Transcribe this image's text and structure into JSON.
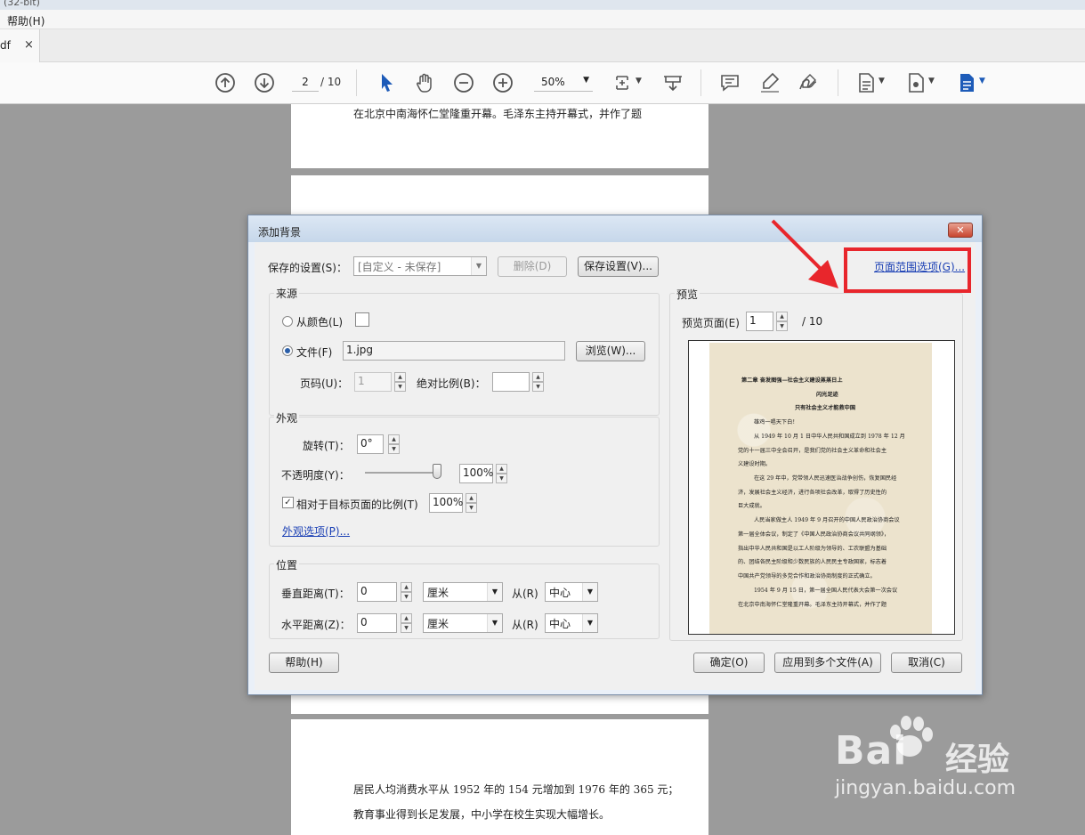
{
  "app": {
    "title_fragment": "(32-bit)",
    "menu": {
      "help": "帮助(H)"
    },
    "tab": {
      "name": "df",
      "close": "×"
    },
    "toolbar": {
      "page_current": "2",
      "page_total": "/ 10",
      "zoom": "50%"
    }
  },
  "document": {
    "page1_line": "在北京中南海怀仁堂隆重开幕。毛泽东主持开幕式，并作了题",
    "page3_line1": "居民人均消费水平从 1952 年的 154 元增加到 1976 年的 365 元；",
    "page3_line2": "教育事业得到长足发展，中小学在校生实现大幅增长。"
  },
  "dialog": {
    "title": "添加背景",
    "close": "✕",
    "saved_settings_label": "保存的设置(S)：",
    "saved_settings_value": "[自定义 - 未保存]",
    "delete_button": "删除(D)",
    "save_settings_button": "保存设置(V)...",
    "page_range_link": "页面范围选项(G)...",
    "source": {
      "title": "来源",
      "from_color": "从颜色(L)",
      "file_label": "文件(F)",
      "file_value": "1.jpg",
      "browse_button": "浏览(W)...",
      "page_label": "页码(U)：",
      "page_value": "1",
      "abs_scale_label": "绝对比例(B)：",
      "abs_scale_value": ""
    },
    "appearance": {
      "title": "外观",
      "rotation_label": "旋转(T)：",
      "rotation_value": "0°",
      "opacity_label": "不透明度(Y)：",
      "opacity_value": "100%",
      "opacity_level": 1.0,
      "relative_scale_label": "相对于目标页面的比例(T)",
      "relative_scale_value": "100%",
      "relative_scale_checked": true,
      "options_link": "外观选项(P)..."
    },
    "position": {
      "title": "位置",
      "vertical_label": "垂直距离(T)：",
      "vertical_value": "0",
      "vertical_unit": "厘米",
      "vertical_from_label": "从(R)",
      "vertical_from": "中心",
      "horizontal_label": "水平距离(Z)：",
      "horizontal_value": "0",
      "horizontal_unit": "厘米",
      "horizontal_from_label": "从(R)",
      "horizontal_from": "中心"
    },
    "preview": {
      "title": "预览",
      "page_label": "预览页面(E)",
      "page_value": "1",
      "page_total": "/ 10",
      "lines": [
        {
          "text": "第二章  奋发图强—社会主义建设蒸蒸日上",
          "bold": true
        },
        {
          "text": "闪光足迹",
          "bold": true
        },
        {
          "text": "只有社会主义才能救中国",
          "bold": true
        },
        {
          "text": "雄鸡一唱天下白！",
          "bold": false
        },
        {
          "text": "从 1949 年 10 月 1 日中华人民共和国成立到 1978 年 12 月",
          "bold": false
        },
        {
          "text": "党的十一届三中全会召开，是我们党的社会主义革命和社会主",
          "bold": false
        },
        {
          "text": "义建设时期。",
          "bold": false
        },
        {
          "text": "在这 29 年中，党带领人民迅速医治战争创伤，恢复国民经",
          "bold": false
        },
        {
          "text": "济，发展社会主义经济，进行各项社会改革，取得了历史性的",
          "bold": false
        },
        {
          "text": "巨大成就。",
          "bold": false
        },
        {
          "text": "人民当家做主人 1949 年 9 月召开的中国人民政治协商会议",
          "bold": false
        },
        {
          "text": "第一届全体会议，制定了《中国人民政治协商会议共同纲领》，",
          "bold": false
        },
        {
          "text": "指出中华人民共和国是以工人阶级为领导的、工农联盟为基础",
          "bold": false
        },
        {
          "text": "的、团结各民主阶级和少数民族的人民民主专政国家，标志着",
          "bold": false
        },
        {
          "text": "中国共产党领导的多党合作和政治协商制度的正式确立。",
          "bold": false
        },
        {
          "text": "1954 年 9 月 15 日，第一届全国人民代表大会第一次会议",
          "bold": false
        },
        {
          "text": "在北京中南海怀仁堂隆重开幕。毛泽东主持开幕式，并作了题",
          "bold": false
        }
      ]
    },
    "help_button": "帮助(H)",
    "ok_button": "确定(O)",
    "apply_multiple_button": "应用到多个文件(A)",
    "cancel_button": "取消(C)"
  },
  "watermark": {
    "brand": "Bai",
    "cn": "经验",
    "url": "jingyan.baidu.com"
  }
}
